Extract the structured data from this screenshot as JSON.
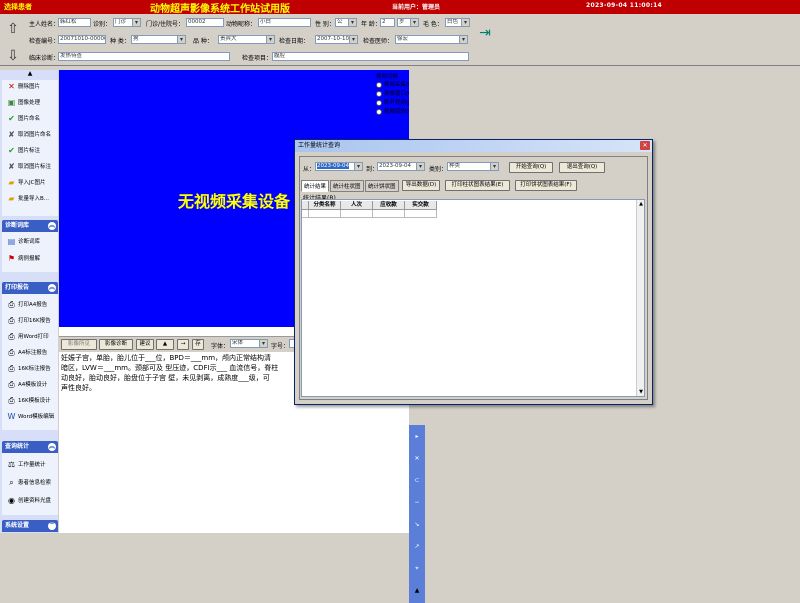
{
  "title_bar": {
    "left_label": "选择患者",
    "app_title": "动物超声影像系统工作站试用版",
    "user": "当前用户：管理员",
    "datetime": "2023-09-04  11:00:14"
  },
  "patient_form": {
    "owner_label": "主人姓名：",
    "owner_value": "韩红松",
    "visit_label": "诊别：",
    "visit_value": "门诊",
    "record_label": "门诊/住院号：",
    "record_value": "00002",
    "nickname_label": "动物昵称：",
    "nickname_value": "小白",
    "sex_label": "性  别：",
    "sex_value": "公",
    "age_label": "年  龄：",
    "age_value": "2",
    "age_unit": "岁",
    "color_label": "毛  色：",
    "color_value": "白色",
    "exam_no_label": "检查编号：",
    "exam_no_value": "20071010-000003",
    "species_label": "种  类：",
    "species_value": "狗",
    "breed_label": "品  种：",
    "breed_value": "贵宾犬",
    "exam_date_label": "检查日期：",
    "exam_date_value": "2007-10-10",
    "doctor_label": "检查医师：",
    "doctor_value": "徐宏",
    "diagnosis_label": "临床诊断：",
    "diagnosis_value": "发热待查",
    "exam_item_label": "检查项目：",
    "exam_item_value": "腹腔"
  },
  "sidebar": {
    "top_items": [
      {
        "label": "删除图片",
        "icon": "x-icon"
      },
      {
        "label": "图像处理",
        "icon": "image-icon"
      },
      {
        "label": "图片命名",
        "icon": "check-icon"
      },
      {
        "label": "取消图片命名",
        "icon": "uncheck-icon"
      },
      {
        "label": "图片标注",
        "icon": "check-icon"
      },
      {
        "label": "取消图片标注",
        "icon": "uncheck-icon"
      },
      {
        "label": "导入JC图片",
        "icon": "folder-icon"
      },
      {
        "label": "批量导入B...",
        "icon": "folder-icon"
      }
    ],
    "groups": [
      {
        "title": "诊断词库",
        "items": [
          {
            "label": "诊断词库",
            "icon": "book-icon"
          },
          {
            "label": "病例报解",
            "icon": "flag-icon"
          }
        ]
      },
      {
        "title": "打印报告",
        "items": [
          {
            "label": "打印A4报告",
            "icon": "printer-icon"
          },
          {
            "label": "打印16K报告",
            "icon": "printer-icon"
          },
          {
            "label": "用Word打印",
            "icon": "printer-icon"
          },
          {
            "label": "A4标注报告",
            "icon": "printer-icon"
          },
          {
            "label": "16K标注报告",
            "icon": "printer-icon"
          },
          {
            "label": "A4模板设计",
            "icon": "printer-icon"
          },
          {
            "label": "16K模板设计",
            "icon": "printer-icon"
          },
          {
            "label": "Word模板编辑",
            "icon": "word-icon"
          }
        ]
      },
      {
        "title": "查询统计",
        "items": [
          {
            "label": "工作量统计",
            "icon": "scale-icon"
          },
          {
            "label": "患者信息检索",
            "icon": "search-icon"
          },
          {
            "label": "创建资料光盘",
            "icon": "disc-icon"
          }
        ]
      },
      {
        "title": "系统设置",
        "items": []
      }
    ]
  },
  "video": {
    "no_device_text": "无视频采集设备",
    "switch_title": "视频切换",
    "options": [
      "视频采集(L)",
      "录像窗口(Q)",
      "断开视频(J)",
      "视频回放(H)"
    ]
  },
  "toolbar": {
    "buttons": [
      "影像所见",
      "影像诊断",
      "建议",
      "▲",
      "→",
      "存"
    ],
    "font_label": "字体：",
    "font_value": "宋体",
    "size_label": "字号："
  },
  "report": {
    "lines": [
      "  妊娠子宫，单胎，胎儿位于___位，BPD＝___mm，颅内正常结构清",
      "暗区，LVW＝___mm。颈部可及  型压迹，CDFI示___ 血流信号，脊柱",
      "动良好，胎动良好，胎盘位于子宫  壁，未见剥离，成熟度___级，可",
      "声性良好。"
    ]
  },
  "dialog": {
    "title": "工作量统计查询",
    "from_label": "从：",
    "from_value": "2023-09-04",
    "to_label": "到：",
    "to_value": "2023-09-04",
    "category_label": "类别：",
    "category_value": "种类",
    "start_query": "开始查询(Q)",
    "exit_query": "退出查询(Q)",
    "tabs": [
      "统计结果",
      "统计柱状图",
      "统计饼状图"
    ],
    "export": "导出数据(D)",
    "print_bar": "打印柱状图表结果(E)",
    "print_pie": "打印饼状图表结果(F)",
    "result_label": "统计结果(B)",
    "columns": [
      "分类名称",
      "人次",
      "应收款",
      "实交款"
    ]
  },
  "colors": {
    "title_bg": "#c00000",
    "title_accent": "#ffff00",
    "video_bg": "#0000ff",
    "sidebar_group": "#3a5fc4"
  }
}
